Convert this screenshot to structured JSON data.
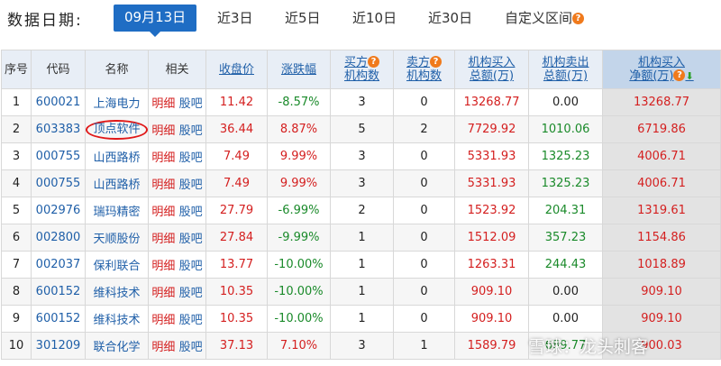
{
  "filter": {
    "label": "数据日期:",
    "tabs": [
      "09月13日",
      "近3日",
      "近5日",
      "近10日",
      "近30日",
      "自定义区间"
    ]
  },
  "columns": [
    "序号",
    "代码",
    "名称",
    "相关",
    "收盘价",
    "涨跌幅",
    "买方\n机构数",
    "卖方\n机构数",
    "机构买入\n总额(万)",
    "机构卖出\n总额(万)",
    "机构买入\n净额(万)"
  ],
  "col_labels": {
    "idx": "序号",
    "code": "代码",
    "name": "名称",
    "rel": "相关",
    "close": "收盘价",
    "chg": "涨跌幅",
    "buy_inst_1": "买方",
    "buy_inst_2": "机构数",
    "sell_inst_1": "卖方",
    "sell_inst_2": "机构数",
    "buy_total_1": "机构买入",
    "buy_total_2": "总额(万)",
    "sell_total_1": "机构卖出",
    "sell_total_2": "总额(万)",
    "net_1": "机构买入",
    "net_2": "净额(万)"
  },
  "link_detail": "明细",
  "link_bar": "股吧",
  "rows": [
    {
      "idx": "1",
      "code": "600021",
      "name": "上海电力",
      "close": "11.42",
      "chg": "-8.57%",
      "buy_n": "3",
      "sell_n": "0",
      "buy_amt": "13268.77",
      "sell_amt": "0.00",
      "net": "13268.77"
    },
    {
      "idx": "2",
      "code": "603383",
      "name": "顶点软件",
      "close": "36.44",
      "chg": "8.87%",
      "buy_n": "5",
      "sell_n": "2",
      "buy_amt": "7729.92",
      "sell_amt": "1010.06",
      "net": "6719.86"
    },
    {
      "idx": "3",
      "code": "000755",
      "name": "山西路桥",
      "close": "7.49",
      "chg": "9.99%",
      "buy_n": "3",
      "sell_n": "0",
      "buy_amt": "5331.93",
      "sell_amt": "1325.23",
      "net": "4006.71"
    },
    {
      "idx": "4",
      "code": "000755",
      "name": "山西路桥",
      "close": "7.49",
      "chg": "9.99%",
      "buy_n": "3",
      "sell_n": "0",
      "buy_amt": "5331.93",
      "sell_amt": "1325.23",
      "net": "4006.71"
    },
    {
      "idx": "5",
      "code": "002976",
      "name": "瑞玛精密",
      "close": "27.79",
      "chg": "-6.99%",
      "buy_n": "2",
      "sell_n": "0",
      "buy_amt": "1523.92",
      "sell_amt": "204.31",
      "net": "1319.61"
    },
    {
      "idx": "6",
      "code": "002800",
      "name": "天顺股份",
      "close": "27.84",
      "chg": "-9.99%",
      "buy_n": "1",
      "sell_n": "0",
      "buy_amt": "1512.09",
      "sell_amt": "357.23",
      "net": "1154.86"
    },
    {
      "idx": "7",
      "code": "002037",
      "name": "保利联合",
      "close": "13.77",
      "chg": "-10.00%",
      "buy_n": "1",
      "sell_n": "0",
      "buy_amt": "1263.31",
      "sell_amt": "244.43",
      "net": "1018.89"
    },
    {
      "idx": "8",
      "code": "600152",
      "name": "维科技术",
      "close": "10.35",
      "chg": "-10.00%",
      "buy_n": "1",
      "sell_n": "0",
      "buy_amt": "909.10",
      "sell_amt": "0.00",
      "net": "909.10"
    },
    {
      "idx": "9",
      "code": "600152",
      "name": "维科技术",
      "close": "10.35",
      "chg": "-10.00%",
      "buy_n": "1",
      "sell_n": "0",
      "buy_amt": "909.10",
      "sell_amt": "0.00",
      "net": "909.10"
    },
    {
      "idx": "10",
      "code": "301209",
      "name": "联合化学",
      "close": "37.13",
      "chg": "7.10%",
      "buy_n": "3",
      "sell_n": "1",
      "buy_amt": "1589.79",
      "sell_amt": "689.77",
      "net": "900.03"
    }
  ],
  "watermark": "雪球：龙头刺客",
  "colors": {
    "accent": "#1f6dc4",
    "up": "#d41f1f",
    "down": "#1a8a2a",
    "question": "#f07a1c",
    "circle": "#e01818"
  }
}
